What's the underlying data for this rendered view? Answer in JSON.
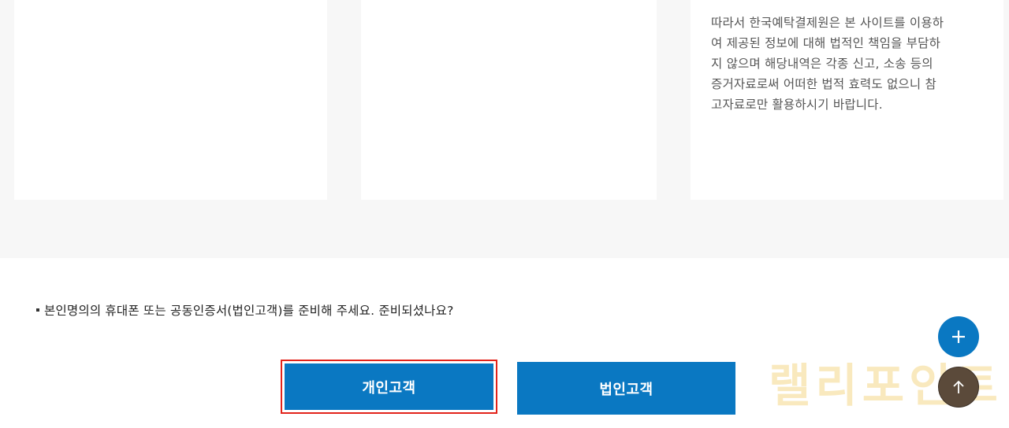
{
  "disclaimer": {
    "lines": [
      "따라서 한국예탁결제원은 본 사이트를 이용하",
      "여 제공된 정보에 대해 법적인 책임을 부담하",
      "지 않으며  해당내역은 각종 신고, 소송 등의",
      "증거자료로써 어떠한 법적 효력도 없으니 참",
      "고자료로만 활용하시기 바랍니다."
    ]
  },
  "notice": {
    "text": "본인명의의 휴대폰 또는 공동인증서(법인고객)를 준비해 주세요. 준비되셨나요?"
  },
  "buttons": {
    "individual": "개인고객",
    "corporate": "법인고객"
  },
  "watermark": {
    "text": "랠리포인트"
  },
  "icons": {
    "plus": "plus-icon",
    "top": "arrow-up-icon"
  },
  "colors": {
    "primary": "#0a78c2",
    "focus": "#e2231a",
    "top_button": "#5b4a3a",
    "background_band": "#f7f7f7"
  }
}
